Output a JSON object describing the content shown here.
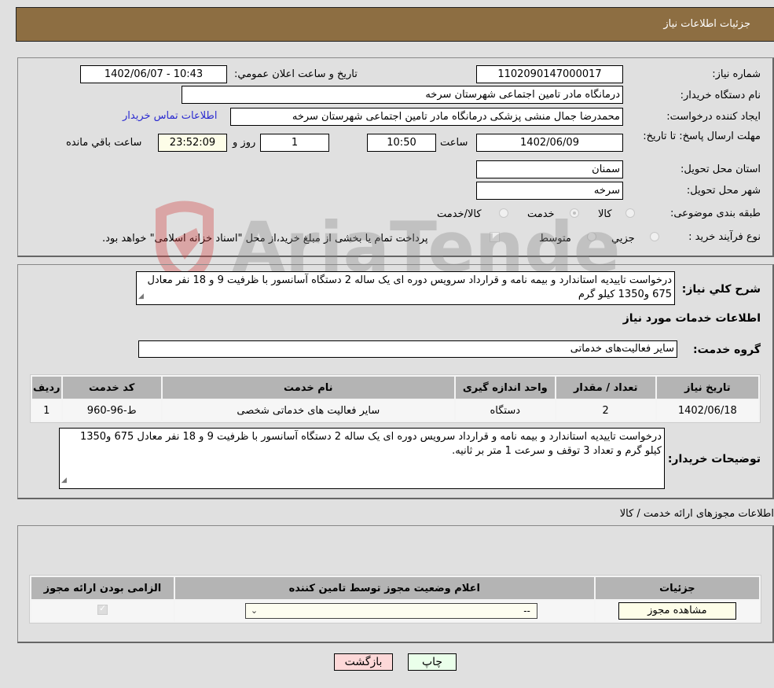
{
  "header": {
    "title": "جزئیات اطلاعات نیاز"
  },
  "info": {
    "need_number": {
      "label": "شماره نیاز:",
      "value": "1102090147000017"
    },
    "announce_datetime": {
      "label": "تاریخ و ساعت اعلان عمومي:",
      "value": "1402/06/07 - 10:43"
    },
    "buyer_org": {
      "label": "نام دستگاه خريدار:",
      "value": "درمانگاه مادر تامین اجتماعی شهرستان سرخه"
    },
    "requester": {
      "label": "ایجاد کننده درخواست:",
      "value": "محمدرضا جمال منشی پزشکی درمانگاه مادر تامین اجتماعی شهرستان سرخه"
    },
    "buyer_contact_link": "اطلاعات تماس خریدار",
    "deadline": {
      "label": "مهلت ارسال پاسخ: تا تاریخ:",
      "date": "1402/06/09",
      "time_label": "ساعت",
      "time": "10:50",
      "days": "1",
      "days_label": "روز و",
      "remaining": "23:52:09",
      "remaining_label": "ساعت باقي مانده"
    },
    "province": {
      "label": "استان محل تحویل:",
      "value": "سمنان"
    },
    "city": {
      "label": "شهر محل تحویل:",
      "value": "سرخه"
    },
    "category": {
      "label": "طبقه بندی موضوعی:",
      "options": [
        "کالا",
        "خدمت",
        "کالا/خدمت"
      ],
      "selected": "خدمت"
    },
    "purchase_type": {
      "label": "نوع فرآیند خرید :",
      "options": [
        "جزيي",
        "متوسط"
      ],
      "note": "پرداخت تمام یا بخشی از مبلغ خرید،از محل \"اسناد خزانه اسلامی\" خواهد بود."
    }
  },
  "description": {
    "label": "شرح کلي نياز:",
    "value": "درخواست تاییدیه استاندارد  و بیمه نامه و قرارداد سرویس دوره ای یک ساله 2 دستگاه آسانسور با ظرفیت 9 و 18 نفر معادل 675 و1350 کیلو گرم"
  },
  "services": {
    "title": "اطلاعات خدمات مورد نياز",
    "group_label": "گروه خدمت:",
    "group_value": "سایر فعالیت‌های خدماتی",
    "columns": [
      "ردیف",
      "کد خدمت",
      "نام خدمت",
      "واحد اندازه گیری",
      "تعداد / مقدار",
      "تاریخ نیاز"
    ],
    "rows": [
      [
        "1",
        "ط-96-960",
        "سایر فعالیت های خدماتی شخصی",
        "دستگاه",
        "2",
        "1402/06/18"
      ]
    ]
  },
  "buyer_notes": {
    "label": "توضیحات خريدار:",
    "value": "درخواست تاییدیه استاندارد  و بیمه نامه و قرارداد سرویس دوره ای یک ساله 2 دستگاه آسانسور با ظرفیت 9 و 18 نفر معادل 675 و1350 کیلو گرم و تعداد 3 توقف و سرعت 1 متر بر ثانیه."
  },
  "licenses": {
    "title": "اطلاعات مجوزهای ارائه خدمت / کالا",
    "columns": [
      "الزامی بودن ارائه مجوز",
      "اعلام وضعیت مجوز توسط تامین کننده",
      "جزئیات"
    ],
    "row": {
      "required_checked": true,
      "status_value": "--",
      "details_button": "مشاهده مجوز"
    }
  },
  "footer": {
    "back_button": "بازگشت",
    "print_button": "چاپ"
  },
  "watermark": {
    "text": "AriaTender.neT"
  }
}
